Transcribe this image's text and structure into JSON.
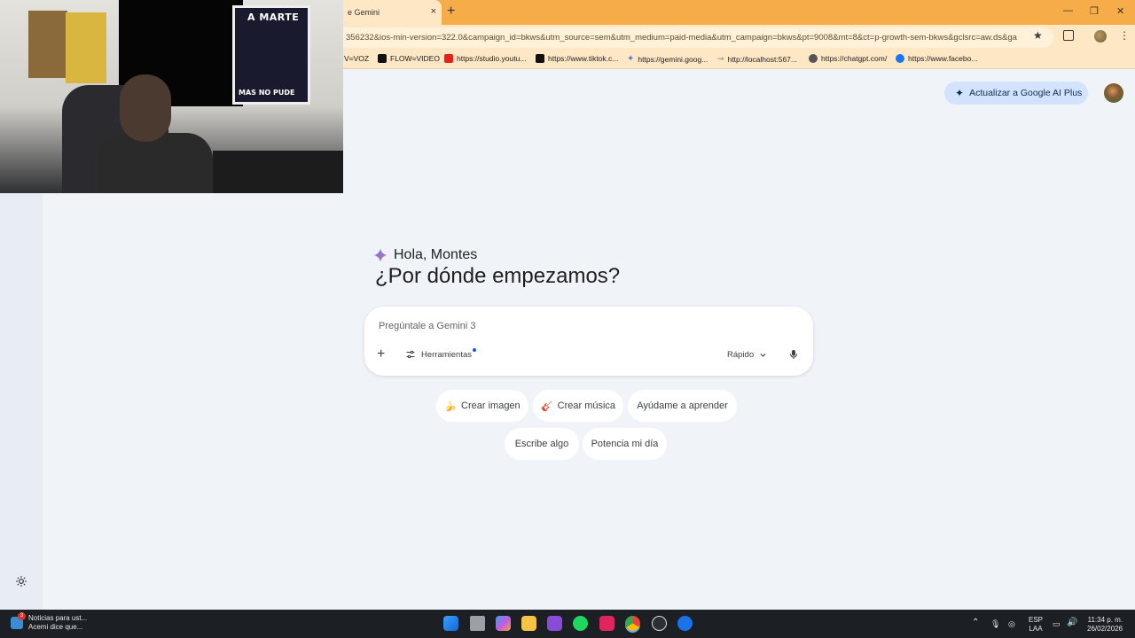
{
  "browser": {
    "tab_title": "e Gemini",
    "tab_close": "×",
    "new_tab": "+",
    "window_minimize": "—",
    "window_restore": "❐",
    "window_close": "✕",
    "url": "356232&ios-min-version=322.0&campaign_id=bkws&utm_source=sem&utm_medium=paid-media&utm_campaign=bkws&pt=9008&mt=8&ct=p-growth-sem-bkws&gclsrc=aw.ds&ga",
    "bookmarks": [
      {
        "label": "V=VOZ",
        "color": ""
      },
      {
        "label": "FLOW=VIDEO",
        "color": "#111111"
      },
      {
        "label": "https://studio.youtu...",
        "color": "#e62117"
      },
      {
        "label": "https://www.tiktok.c...",
        "color": "#111111"
      },
      {
        "label": "https://gemini.goog...",
        "color": "#4f7de8"
      },
      {
        "label": "http://localhost:567...",
        "color": "#888888"
      },
      {
        "label": "https://chatgpt.com/",
        "color": "#555555"
      },
      {
        "label": "https://www.facebo...",
        "color": "#1877f2"
      }
    ]
  },
  "webcam": {
    "poster_top_text": "A MARTE",
    "poster_bottom_text": "MAS NO PUDE"
  },
  "header": {
    "upgrade_label": "Actualizar a Google AI Plus"
  },
  "main": {
    "greeting": "Hola, Montes",
    "headline": "¿Por dónde empezamos?",
    "prompt_placeholder": "Pregúntale a Gemini 3",
    "add_label": "+",
    "tools_label": "Herramientas",
    "mode_label": "Rápido"
  },
  "chips": [
    {
      "label": "Crear imagen",
      "emoji": "🍌"
    },
    {
      "label": "Crear música",
      "emoji": "🎸"
    },
    {
      "label": "Ayúdame a aprender",
      "emoji": ""
    },
    {
      "label": "Escribe algo",
      "emoji": ""
    },
    {
      "label": "Potencia mi día",
      "emoji": ""
    }
  ],
  "taskbar": {
    "news_badge": "3",
    "news_title": "Noticias para ust...",
    "news_subtitle": "Acemi dice que...",
    "language_line1": "ESP",
    "language_line2": "LAA",
    "time": "11:34 p. m.",
    "date": "26/02/2026",
    "apps": [
      "windows-start",
      "file-explorer-window",
      "copilot",
      "folder",
      "podcasts",
      "spotify",
      "tiktok",
      "chrome",
      "browser-alt",
      "power-app"
    ]
  },
  "colors": {
    "tabstrip": "#f6ac49",
    "toolbar": "#fde7c4",
    "page_bg": "#f0f4f9",
    "upgrade_bg": "#d3e3fd",
    "taskbar": "#1c1f24"
  }
}
